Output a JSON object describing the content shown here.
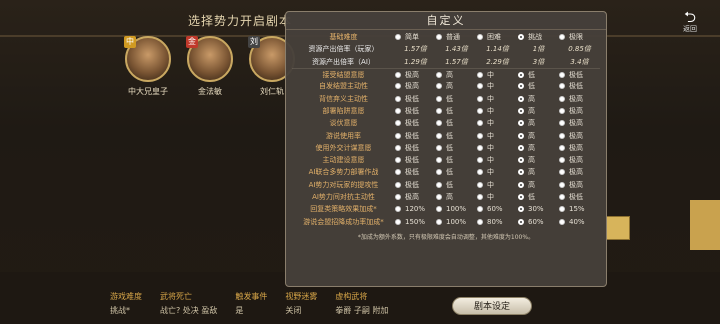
{
  "header": {
    "title": "选择势力开启剧本",
    "back_label": "返回"
  },
  "heroes": [
    {
      "name": "中大兄皇子",
      "badge": "中",
      "badge_color": "#d09a22"
    },
    {
      "name": "金法敏",
      "badge": "金",
      "badge_color": "#c0392b"
    },
    {
      "name": "刘仁轨",
      "badge": "刘",
      "badge_color": "#444444"
    }
  ],
  "modal": {
    "title": "自定义",
    "difficulty": {
      "label": "基础难度",
      "options": [
        "简单",
        "普通",
        "困难",
        "挑战",
        "极限"
      ],
      "selected": 3
    },
    "player_rate": {
      "label": "资源产出倍率（玩家）",
      "values": [
        "1.57倍",
        "1.43倍",
        "1.14倍",
        "1倍",
        "0.85倍"
      ]
    },
    "ai_rate": {
      "label": "资源产出倍率（AI）",
      "values": [
        "1.29倍",
        "1.57倍",
        "2.29倍",
        "3倍",
        "3.4倍"
      ]
    },
    "settings": [
      {
        "label": "接受结盟意愿",
        "options": [
          "极高",
          "高",
          "中",
          "低",
          "极低"
        ],
        "selected": 3
      },
      {
        "label": "自发结盟主动性",
        "options": [
          "极高",
          "高",
          "中",
          "低",
          "极低"
        ],
        "selected": 3
      },
      {
        "label": "背信弃义主动性",
        "options": [
          "极低",
          "低",
          "中",
          "高",
          "极高"
        ],
        "selected": 3
      },
      {
        "label": "部署陷阱意愿",
        "options": [
          "极低",
          "低",
          "中",
          "高",
          "极高"
        ],
        "selected": 3
      },
      {
        "label": "谈伏意愿",
        "options": [
          "极低",
          "低",
          "中",
          "高",
          "极高"
        ],
        "selected": 3
      },
      {
        "label": "游说使用率",
        "options": [
          "极低",
          "低",
          "中",
          "高",
          "极高"
        ],
        "selected": 3
      },
      {
        "label": "使用外交计谋意愿",
        "options": [
          "极低",
          "低",
          "中",
          "高",
          "极高"
        ],
        "selected": 3
      },
      {
        "label": "主动建设意愿",
        "options": [
          "极低",
          "低",
          "中",
          "高",
          "极高"
        ],
        "selected": 3
      },
      {
        "label": "AI联合多势力部署作战",
        "options": [
          "极低",
          "低",
          "中",
          "高",
          "极高"
        ],
        "selected": 3
      },
      {
        "label": "AI势力对玩家的提攻性",
        "options": [
          "极低",
          "低",
          "中",
          "高",
          "极高"
        ],
        "selected": 3
      },
      {
        "label": "AI势力间对抗主动性",
        "options": [
          "极高",
          "高",
          "中",
          "低",
          "极低"
        ],
        "selected": 3
      },
      {
        "label": "回复类策略效果加成*",
        "options": [
          "120%",
          "100%",
          "60%",
          "30%",
          "15%"
        ],
        "selected": 3
      },
      {
        "label": "游说会盟招降成功率加成*",
        "options": [
          "150%",
          "100%",
          "80%",
          "60%",
          "40%"
        ],
        "selected": 3
      }
    ],
    "note": "*加成为额外系数，只有极限难度会自动调整，其他难度为100%。"
  },
  "bottom_info": [
    {
      "key": "游戏难度",
      "value": "挑战*"
    },
    {
      "key": "武将死亡",
      "value": "战亡? 处决 盈敌"
    },
    {
      "key": "触发事件",
      "value": "是"
    },
    {
      "key": "视野迷雾",
      "value": "关闭"
    },
    {
      "key": "虚构武将",
      "value": "拳爵 子嗣 附加"
    }
  ],
  "script_button": "剧本设定",
  "colors": {
    "accent": "#e3b16a",
    "gold": "#d6a548",
    "modal_bg": "#46403a"
  }
}
